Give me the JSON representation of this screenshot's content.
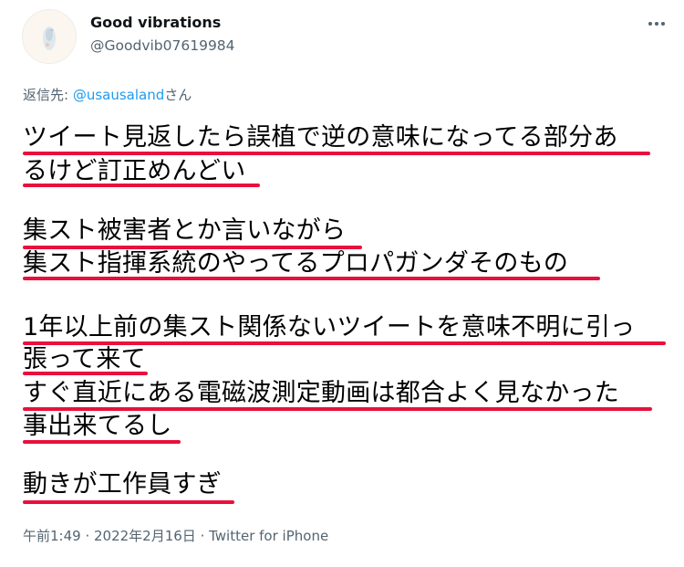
{
  "author": {
    "display_name": "Good vibrations",
    "handle": "@Goodvib07619984"
  },
  "reply": {
    "prefix": "返信先: ",
    "mention": "@usausaland",
    "suffix": "さん"
  },
  "tweet_lines": [
    "ツイート見返したら誤植で逆の意味になってる部分あ",
    "るけど訂正めんどい",
    "集スト被害者とか言いながら",
    "集スト指揮系統のやってるプロパガンダそのもの",
    "1年以上前の集スト関係ないツイートを意味不明に引っ",
    "張って来て",
    "すぐ直近にある電磁波測定動画は都合よく見なかった",
    "事出来てるし",
    "動きが工作員すぎ"
  ],
  "timestamp": {
    "time_date": "午前1:49 · 2022年2月16日",
    "separator": " · ",
    "source": "Twitter for iPhone"
  },
  "annotation_color": "#e8103c"
}
